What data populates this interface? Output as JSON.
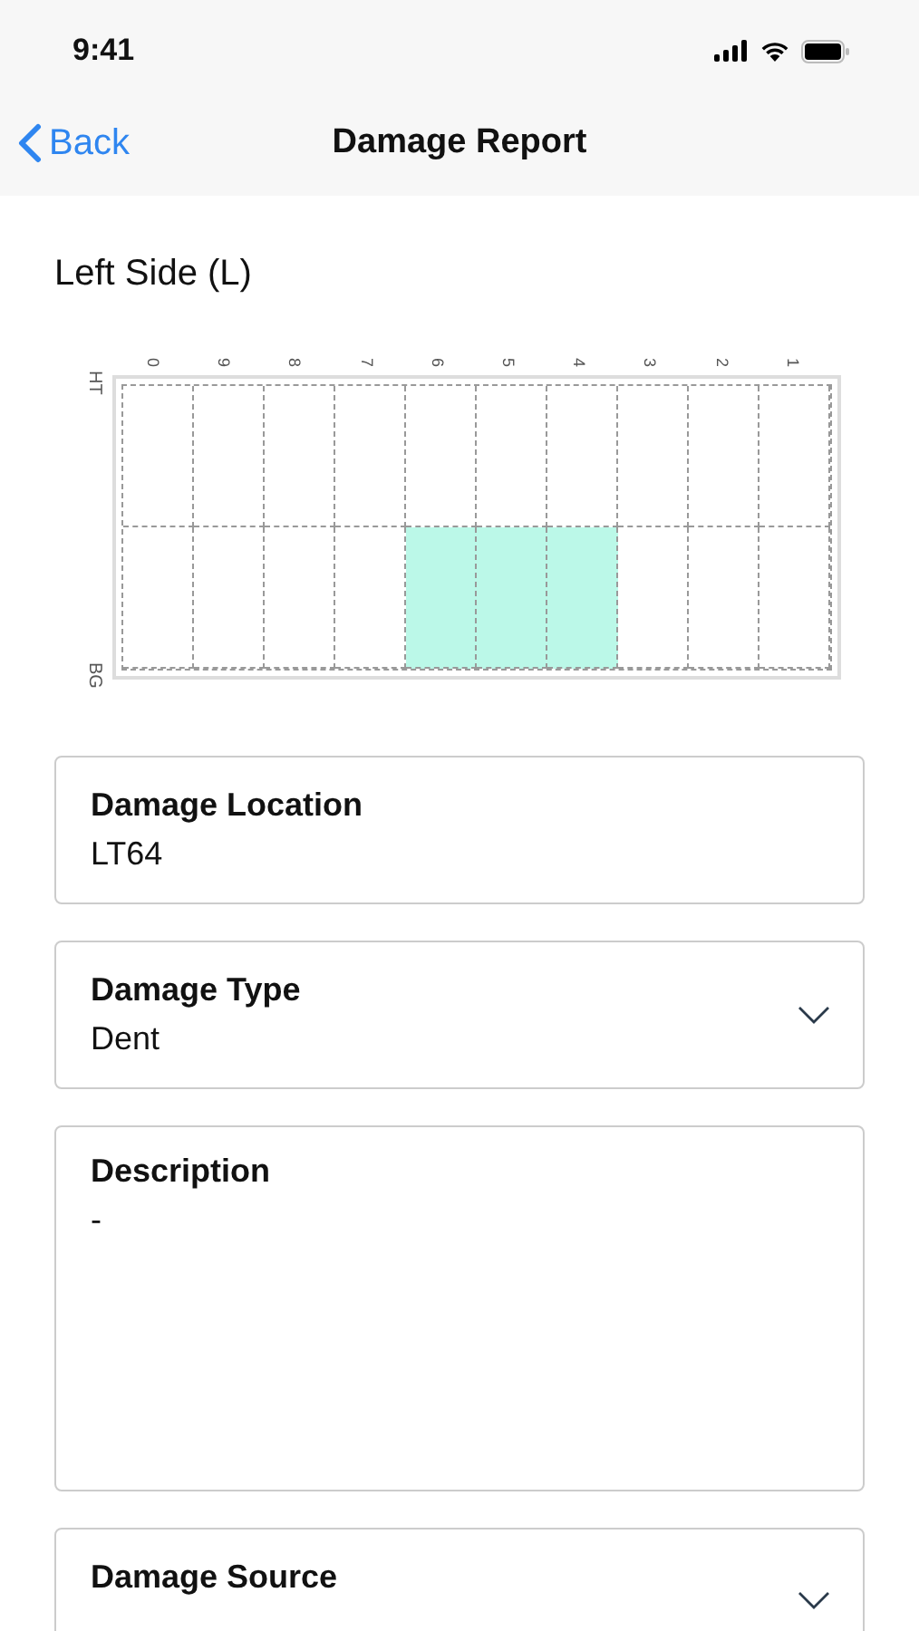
{
  "status_bar": {
    "time": "9:41"
  },
  "nav": {
    "back": "Back",
    "title": "Damage Report"
  },
  "section_title": "Left Side (L)",
  "grid": {
    "columns": [
      "0",
      "9",
      "8",
      "7",
      "6",
      "5",
      "4",
      "3",
      "2",
      "1"
    ],
    "row_labels": [
      "HT",
      "BG"
    ],
    "rows": [
      {
        "cells": [
          {
            "selected": false
          },
          {
            "selected": false
          },
          {
            "selected": false
          },
          {
            "selected": false
          },
          {
            "selected": false
          },
          {
            "selected": false
          },
          {
            "selected": false
          },
          {
            "selected": false
          },
          {
            "selected": false
          },
          {
            "selected": false
          }
        ]
      },
      {
        "cells": [
          {
            "selected": false
          },
          {
            "selected": false
          },
          {
            "selected": false
          },
          {
            "selected": false
          },
          {
            "selected": true
          },
          {
            "selected": true
          },
          {
            "selected": true
          },
          {
            "selected": false
          },
          {
            "selected": false
          },
          {
            "selected": false
          }
        ]
      }
    ]
  },
  "fields": [
    {
      "kind": "text",
      "label": "Damage Location",
      "value": "LT64"
    },
    {
      "kind": "dropdown",
      "label": "Damage Type",
      "value": "Dent"
    },
    {
      "kind": "textarea",
      "label": "Description",
      "value": "-"
    },
    {
      "kind": "dropdown",
      "label": "Damage Source"
    }
  ]
}
